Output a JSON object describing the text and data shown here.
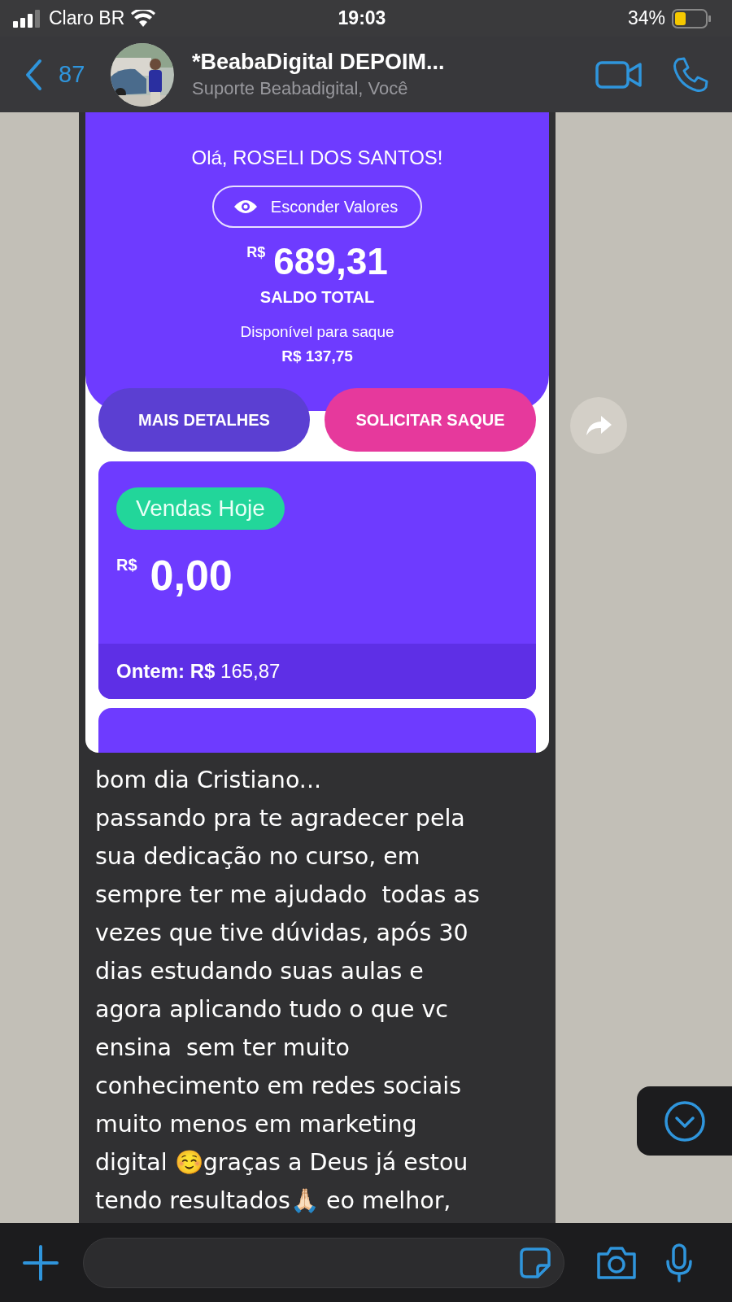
{
  "status_bar": {
    "carrier": "Claro BR",
    "time": "19:03",
    "battery": "34%"
  },
  "header": {
    "back_count": "87",
    "title": "*BeabaDigital DEPOIM...",
    "subtitle": "Suporte Beabadigital, Você"
  },
  "message": {
    "screenshot": {
      "greeting": "Olá, ROSELI DOS SANTOS!",
      "hide_button": "Esconder Valores",
      "currency": "R$",
      "total": "689,31",
      "total_label": "SALDO TOTAL",
      "available_label": "Disponível para saque",
      "available_value": "R$ 137,75",
      "buttons": [
        {
          "label": "MAIS DETALHES",
          "kind": "secondary"
        },
        {
          "label": "SOLICITAR SAQUE",
          "kind": "primary"
        }
      ],
      "sales_card": {
        "badge": "Vendas Hoje",
        "currency": "R$",
        "amount": "0,00",
        "yesterday": "**Ontem: R$** 165,87"
      }
    },
    "text": "bom dia Cristiano...\npassando pra te agradecer pela\nsua dedicação no curso, em\nsempre ter me ajudado  todas as\nvezes que tive dúvidas, após 30\ndias estudando suas aulas e\nagora aplicando tudo o que vc\nensina  sem ter muito\nconhecimento em redes sociais\nmuito menos em marketing\ndigital ☺️graças a Deus já estou\ntendo resultados🙏🏻 eo melhor,"
  }
}
